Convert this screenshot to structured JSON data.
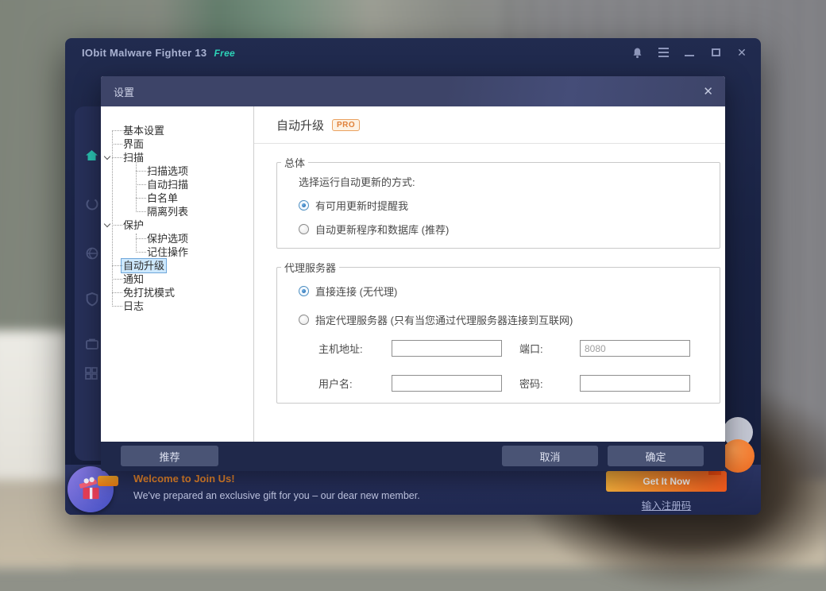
{
  "window": {
    "title": "IObit Malware Fighter 13",
    "edition": "Free"
  },
  "icons": {
    "close": "✕"
  },
  "dialog": {
    "title": "设置",
    "tree": [
      {
        "label": "基本设置",
        "level": 0
      },
      {
        "label": "界面",
        "level": 0
      },
      {
        "label": "扫描",
        "level": 0,
        "expanded": true
      },
      {
        "label": "扫描选项",
        "level": 1
      },
      {
        "label": "自动扫描",
        "level": 1
      },
      {
        "label": "白名单",
        "level": 1
      },
      {
        "label": "隔离列表",
        "level": 1
      },
      {
        "label": "保护",
        "level": 0,
        "expanded": true
      },
      {
        "label": "保护选项",
        "level": 1
      },
      {
        "label": "记住操作",
        "level": 1
      },
      {
        "label": "自动升级",
        "level": 0,
        "selected": true
      },
      {
        "label": "通知",
        "level": 0
      },
      {
        "label": "免打扰模式",
        "level": 0
      },
      {
        "label": "日志",
        "level": 0
      }
    ],
    "content": {
      "title": "自动升级",
      "pro_badge": "PRO",
      "general": {
        "legend": "总体",
        "caption": "选择运行自动更新的方式:",
        "radio_notify": {
          "label": "有可用更新时提醒我",
          "selected": true
        },
        "radio_auto": {
          "label": "自动更新程序和数据库 (推荐)",
          "selected": false
        }
      },
      "proxy": {
        "legend": "代理服务器",
        "radio_direct": {
          "label": "直接连接 (无代理)",
          "selected": true
        },
        "radio_custom": {
          "label": "指定代理服务器 (只有当您通过代理服务器连接到互联网)",
          "selected": false
        },
        "host_label": "主机地址:",
        "host_value": "",
        "port_label": "端口:",
        "port_value": "8080",
        "user_label": "用户名:",
        "user_value": "",
        "pass_label": "密码:",
        "pass_value": ""
      }
    },
    "footer": {
      "recommend": "推荐",
      "cancel": "取消",
      "ok": "确定"
    }
  },
  "banner": {
    "title": "Welcome to Join Us!",
    "subtitle": "We've prepared an exclusive gift for you – our dear new member.",
    "cta": "Get It Now",
    "register_link": "输入注册码"
  }
}
